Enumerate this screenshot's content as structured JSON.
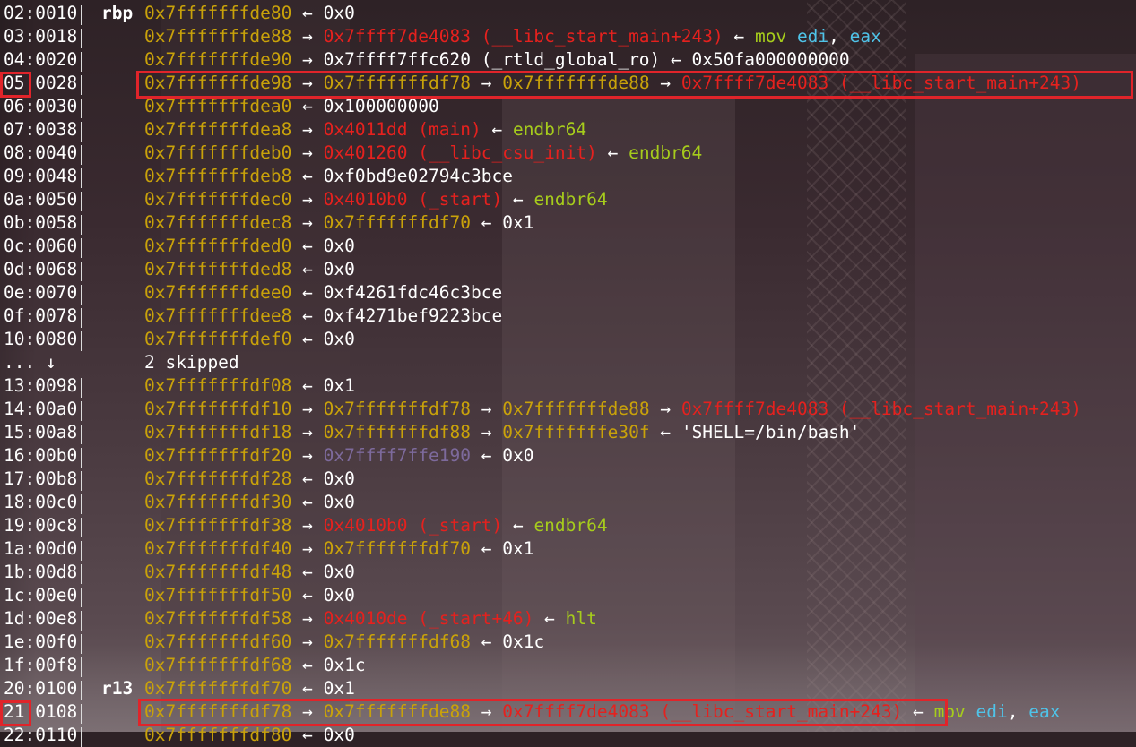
{
  "colors": {
    "stack_address": "#c9a20a",
    "code_pointer": "#e5211e",
    "instruction": "#a6cc1c",
    "register": "#4fc3e8",
    "plain": "#ffffff",
    "mapped_pointer": "#7d6a9c",
    "highlight_box": "#e0242a"
  },
  "rows": [
    {
      "idx": "02:0010",
      "reg": "rbp",
      "parts": [
        {
          "t": "0x7fffffffde80",
          "c": "y"
        },
        {
          "t": " ← ",
          "c": "w"
        },
        {
          "t": "0x0",
          "c": "w"
        }
      ]
    },
    {
      "idx": "03:0018",
      "reg": "",
      "parts": [
        {
          "t": "0x7fffffffde88",
          "c": "y"
        },
        {
          "t": " → ",
          "c": "w"
        },
        {
          "t": "0x7ffff7de4083 (__libc_start_main+243)",
          "c": "r"
        },
        {
          "t": " ← ",
          "c": "w"
        },
        {
          "t": "mov ",
          "c": "g"
        },
        {
          "t": "edi",
          "c": "c"
        },
        {
          "t": ", ",
          "c": "w"
        },
        {
          "t": "eax",
          "c": "c"
        }
      ]
    },
    {
      "idx": "04:0020",
      "reg": "",
      "parts": [
        {
          "t": "0x7fffffffde90",
          "c": "y"
        },
        {
          "t": " → ",
          "c": "w"
        },
        {
          "t": "0x7ffff7ffc620 (_rtld_global_ro)",
          "c": "w"
        },
        {
          "t": " ← ",
          "c": "w"
        },
        {
          "t": "0x50fa000000000",
          "c": "w"
        }
      ]
    },
    {
      "idx": "05:0028",
      "reg": "",
      "parts": [
        {
          "t": "0x7fffffffde98",
          "c": "y"
        },
        {
          "t": " → ",
          "c": "w"
        },
        {
          "t": "0x7fffffffdf78",
          "c": "y"
        },
        {
          "t": " → ",
          "c": "w"
        },
        {
          "t": "0x7fffffffde88",
          "c": "y"
        },
        {
          "t": " → ",
          "c": "w"
        },
        {
          "t": "0x7ffff7de4083 (__libc_start_main+243)",
          "c": "r"
        }
      ]
    },
    {
      "idx": "06:0030",
      "reg": "",
      "parts": [
        {
          "t": "0x7fffffffdea0",
          "c": "y"
        },
        {
          "t": " ← ",
          "c": "w"
        },
        {
          "t": "0x100000000",
          "c": "w"
        }
      ]
    },
    {
      "idx": "07:0038",
      "reg": "",
      "parts": [
        {
          "t": "0x7fffffffdea8",
          "c": "y"
        },
        {
          "t": " → ",
          "c": "w"
        },
        {
          "t": "0x4011dd (main)",
          "c": "r"
        },
        {
          "t": " ← ",
          "c": "w"
        },
        {
          "t": "endbr64",
          "c": "g"
        }
      ]
    },
    {
      "idx": "08:0040",
      "reg": "",
      "parts": [
        {
          "t": "0x7fffffffdeb0",
          "c": "y"
        },
        {
          "t": " → ",
          "c": "w"
        },
        {
          "t": "0x401260 (__libc_csu_init)",
          "c": "r"
        },
        {
          "t": " ← ",
          "c": "w"
        },
        {
          "t": "endbr64",
          "c": "g"
        }
      ]
    },
    {
      "idx": "09:0048",
      "reg": "",
      "parts": [
        {
          "t": "0x7fffffffdeb8",
          "c": "y"
        },
        {
          "t": " ← ",
          "c": "w"
        },
        {
          "t": "0xf0bd9e02794c3bce",
          "c": "w"
        }
      ]
    },
    {
      "idx": "0a:0050",
      "reg": "",
      "parts": [
        {
          "t": "0x7fffffffdec0",
          "c": "y"
        },
        {
          "t": " → ",
          "c": "w"
        },
        {
          "t": "0x4010b0 (_start)",
          "c": "r"
        },
        {
          "t": " ← ",
          "c": "w"
        },
        {
          "t": "endbr64",
          "c": "g"
        }
      ]
    },
    {
      "idx": "0b:0058",
      "reg": "",
      "parts": [
        {
          "t": "0x7fffffffdec8",
          "c": "y"
        },
        {
          "t": " → ",
          "c": "w"
        },
        {
          "t": "0x7fffffffdf70",
          "c": "y"
        },
        {
          "t": " ← ",
          "c": "w"
        },
        {
          "t": "0x1",
          "c": "w"
        }
      ]
    },
    {
      "idx": "0c:0060",
      "reg": "",
      "parts": [
        {
          "t": "0x7fffffffded0",
          "c": "y"
        },
        {
          "t": " ← ",
          "c": "w"
        },
        {
          "t": "0x0",
          "c": "w"
        }
      ]
    },
    {
      "idx": "0d:0068",
      "reg": "",
      "parts": [
        {
          "t": "0x7fffffffded8",
          "c": "y"
        },
        {
          "t": " ← ",
          "c": "w"
        },
        {
          "t": "0x0",
          "c": "w"
        }
      ]
    },
    {
      "idx": "0e:0070",
      "reg": "",
      "parts": [
        {
          "t": "0x7fffffffdee0",
          "c": "y"
        },
        {
          "t": " ← ",
          "c": "w"
        },
        {
          "t": "0xf4261fdc46c3bce",
          "c": "w"
        }
      ]
    },
    {
      "idx": "0f:0078",
      "reg": "",
      "parts": [
        {
          "t": "0x7fffffffdee8",
          "c": "y"
        },
        {
          "t": " ← ",
          "c": "w"
        },
        {
          "t": "0xf4271bef9223bce",
          "c": "w"
        }
      ]
    },
    {
      "idx": "10:0080",
      "reg": "",
      "parts": [
        {
          "t": "0x7fffffffdef0",
          "c": "y"
        },
        {
          "t": " ← ",
          "c": "w"
        },
        {
          "t": "0x0",
          "c": "w"
        }
      ]
    },
    {
      "idx": "... ↓",
      "reg": "",
      "noSep": true,
      "parts": [
        {
          "t": "2 skipped",
          "c": "w"
        }
      ]
    },
    {
      "idx": "13:0098",
      "reg": "",
      "parts": [
        {
          "t": "0x7fffffffdf08",
          "c": "y"
        },
        {
          "t": " ← ",
          "c": "w"
        },
        {
          "t": "0x1",
          "c": "w"
        }
      ]
    },
    {
      "idx": "14:00a0",
      "reg": "",
      "parts": [
        {
          "t": "0x7fffffffdf10",
          "c": "y"
        },
        {
          "t": " → ",
          "c": "w"
        },
        {
          "t": "0x7fffffffdf78",
          "c": "y"
        },
        {
          "t": " → ",
          "c": "w"
        },
        {
          "t": "0x7fffffffde88",
          "c": "y"
        },
        {
          "t": " → ",
          "c": "w"
        },
        {
          "t": "0x7ffff7de4083 (__libc_start_main+243)",
          "c": "r"
        }
      ]
    },
    {
      "idx": "15:00a8",
      "reg": "",
      "parts": [
        {
          "t": "0x7fffffffdf18",
          "c": "y"
        },
        {
          "t": " → ",
          "c": "w"
        },
        {
          "t": "0x7fffffffdf88",
          "c": "y"
        },
        {
          "t": " → ",
          "c": "w"
        },
        {
          "t": "0x7fffffffe30f",
          "c": "y"
        },
        {
          "t": " ← ",
          "c": "w"
        },
        {
          "t": "'SHELL=/bin/bash'",
          "c": "w"
        }
      ]
    },
    {
      "idx": "16:00b0",
      "reg": "",
      "parts": [
        {
          "t": "0x7fffffffdf20",
          "c": "y"
        },
        {
          "t": " → ",
          "c": "w"
        },
        {
          "t": "0x7ffff7ffe190",
          "c": "p"
        },
        {
          "t": " ← ",
          "c": "w"
        },
        {
          "t": "0x0",
          "c": "w"
        }
      ]
    },
    {
      "idx": "17:00b8",
      "reg": "",
      "parts": [
        {
          "t": "0x7fffffffdf28",
          "c": "y"
        },
        {
          "t": " ← ",
          "c": "w"
        },
        {
          "t": "0x0",
          "c": "w"
        }
      ]
    },
    {
      "idx": "18:00c0",
      "reg": "",
      "parts": [
        {
          "t": "0x7fffffffdf30",
          "c": "y"
        },
        {
          "t": " ← ",
          "c": "w"
        },
        {
          "t": "0x0",
          "c": "w"
        }
      ]
    },
    {
      "idx": "19:00c8",
      "reg": "",
      "parts": [
        {
          "t": "0x7fffffffdf38",
          "c": "y"
        },
        {
          "t": " → ",
          "c": "w"
        },
        {
          "t": "0x4010b0 (_start)",
          "c": "r"
        },
        {
          "t": " ← ",
          "c": "w"
        },
        {
          "t": "endbr64",
          "c": "g"
        }
      ]
    },
    {
      "idx": "1a:00d0",
      "reg": "",
      "parts": [
        {
          "t": "0x7fffffffdf40",
          "c": "y"
        },
        {
          "t": " → ",
          "c": "w"
        },
        {
          "t": "0x7fffffffdf70",
          "c": "y"
        },
        {
          "t": " ← ",
          "c": "w"
        },
        {
          "t": "0x1",
          "c": "w"
        }
      ]
    },
    {
      "idx": "1b:00d8",
      "reg": "",
      "parts": [
        {
          "t": "0x7fffffffdf48",
          "c": "y"
        },
        {
          "t": " ← ",
          "c": "w"
        },
        {
          "t": "0x0",
          "c": "w"
        }
      ]
    },
    {
      "idx": "1c:00e0",
      "reg": "",
      "parts": [
        {
          "t": "0x7fffffffdf50",
          "c": "y"
        },
        {
          "t": " ← ",
          "c": "w"
        },
        {
          "t": "0x0",
          "c": "w"
        }
      ]
    },
    {
      "idx": "1d:00e8",
      "reg": "",
      "parts": [
        {
          "t": "0x7fffffffdf58",
          "c": "y"
        },
        {
          "t": " → ",
          "c": "w"
        },
        {
          "t": "0x4010de (_start+46)",
          "c": "r"
        },
        {
          "t": " ← ",
          "c": "w"
        },
        {
          "t": "hlt",
          "c": "g"
        }
      ]
    },
    {
      "idx": "1e:00f0",
      "reg": "",
      "parts": [
        {
          "t": "0x7fffffffdf60",
          "c": "y"
        },
        {
          "t": " → ",
          "c": "w"
        },
        {
          "t": "0x7fffffffdf68",
          "c": "y"
        },
        {
          "t": " ← ",
          "c": "w"
        },
        {
          "t": "0x1c",
          "c": "w"
        }
      ]
    },
    {
      "idx": "1f:00f8",
      "reg": "",
      "parts": [
        {
          "t": "0x7fffffffdf68",
          "c": "y"
        },
        {
          "t": " ← ",
          "c": "w"
        },
        {
          "t": "0x1c",
          "c": "w"
        }
      ]
    },
    {
      "idx": "20:0100",
      "reg": "r13",
      "parts": [
        {
          "t": "0x7fffffffdf70",
          "c": "y"
        },
        {
          "t": " ← ",
          "c": "w"
        },
        {
          "t": "0x1",
          "c": "w"
        }
      ]
    },
    {
      "idx": "21:0108",
      "reg": "",
      "parts": [
        {
          "t": "0x7fffffffdf78",
          "c": "y"
        },
        {
          "t": " → ",
          "c": "w"
        },
        {
          "t": "0x7fffffffde88",
          "c": "y"
        },
        {
          "t": " → ",
          "c": "w"
        },
        {
          "t": "0x7ffff7de4083 (__libc_start_main+243)",
          "c": "r"
        },
        {
          "t": " ← ",
          "c": "w"
        },
        {
          "t": "mov ",
          "c": "g"
        },
        {
          "t": "edi",
          "c": "c"
        },
        {
          "t": ", ",
          "c": "w"
        },
        {
          "t": "eax",
          "c": "c"
        }
      ]
    },
    {
      "idx": "22:0110",
      "reg": "",
      "parts": [
        {
          "t": "0x7fffffffdf80",
          "c": "y"
        },
        {
          "t": " ← ",
          "c": "w"
        },
        {
          "t": "0x0",
          "c": "w"
        }
      ]
    }
  ]
}
